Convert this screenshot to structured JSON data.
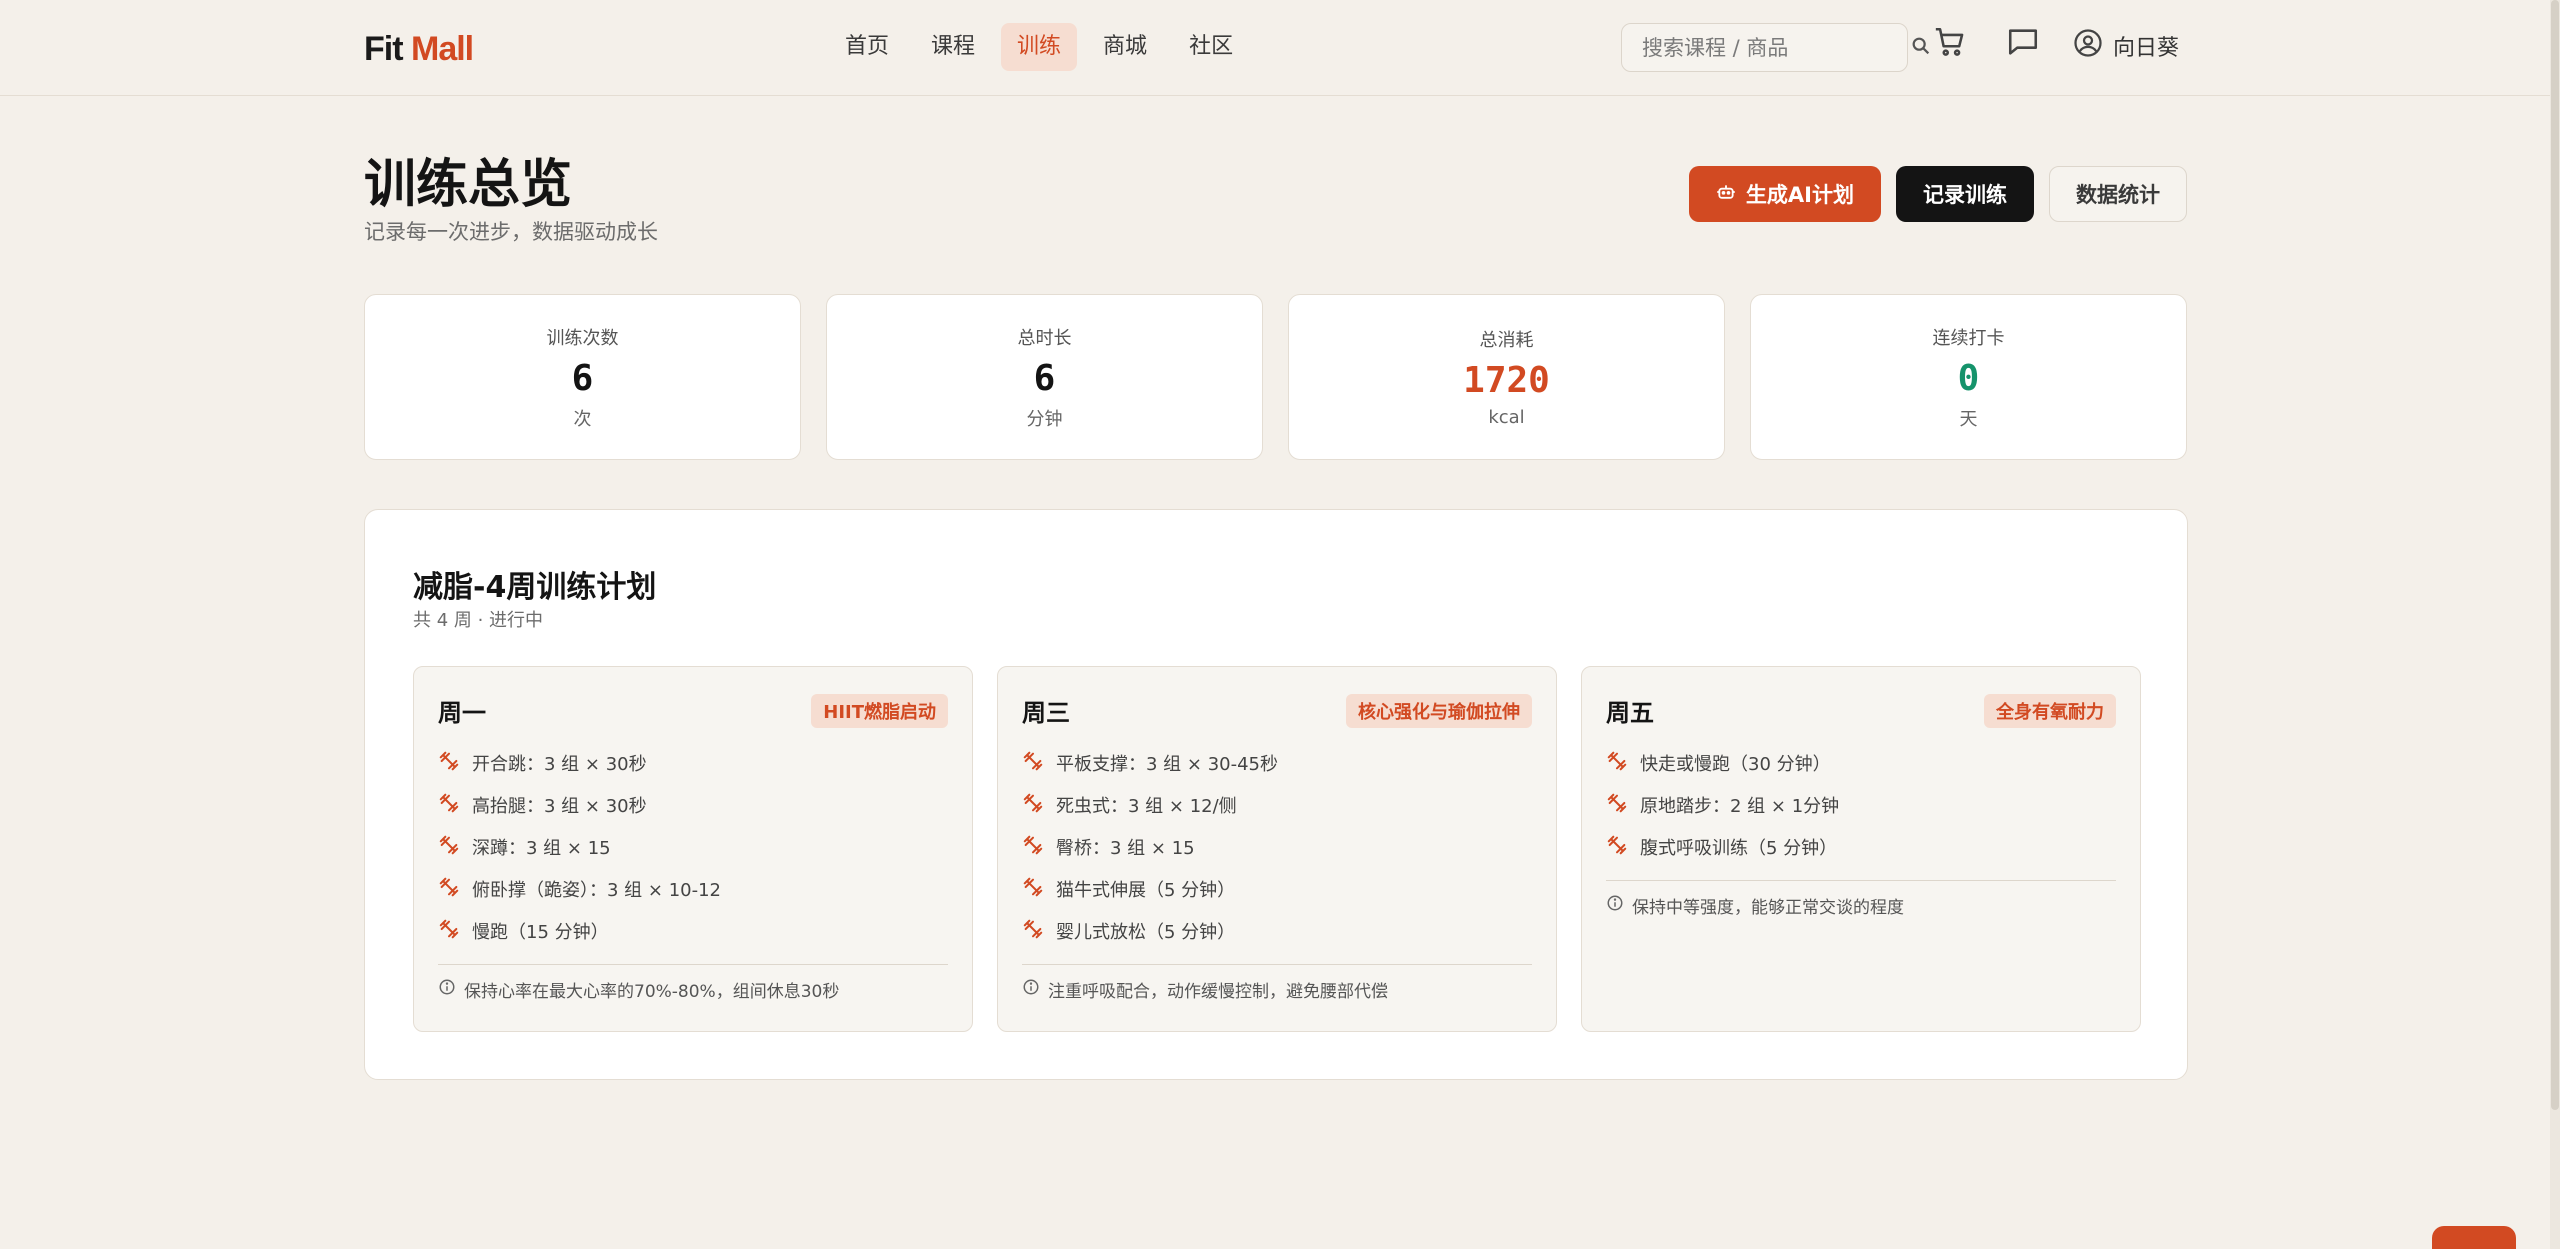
{
  "app": {
    "logo_primary": "Fit",
    "logo_accent": "Mall",
    "accent_color": "#d24a22"
  },
  "nav": {
    "items": [
      {
        "label": "首页",
        "active": false
      },
      {
        "label": "课程",
        "active": false
      },
      {
        "label": "训练",
        "active": true
      },
      {
        "label": "商城",
        "active": false
      },
      {
        "label": "社区",
        "active": false
      }
    ]
  },
  "search": {
    "placeholder": "搜索课程 / 商品",
    "icon": "search-icon"
  },
  "header_icons": [
    "cart-icon",
    "message-icon"
  ],
  "user": {
    "name": "向日葵",
    "icon": "user-circle-icon"
  },
  "page": {
    "title": "训练总览",
    "subtitle": "记录每一次进步，数据驱动成长"
  },
  "actions": {
    "ai_plan": "生成AI计划",
    "record": "记录训练",
    "stats": "数据统计"
  },
  "stats": [
    {
      "label": "训练次数",
      "value": "6",
      "unit": "次",
      "color": "#141414"
    },
    {
      "label": "总时长",
      "value": "6",
      "unit": "分钟",
      "color": "#141414"
    },
    {
      "label": "总消耗",
      "value": "1720",
      "unit": "kcal",
      "color": "#d24a22"
    },
    {
      "label": "连续打卡",
      "value": "0",
      "unit": "天",
      "color": "#15936b"
    }
  ],
  "plan": {
    "title": "减脂-4周训练计划",
    "meta": "共 4 周 · 进行中",
    "days": [
      {
        "name": "周一",
        "tag": "HIIT燃脂启动",
        "exercises": [
          "开合跳：3 组 × 30秒",
          "高抬腿：3 组 × 30秒",
          "深蹲：3 组 × 15",
          "俯卧撑（跪姿）：3 组 × 10-12",
          "慢跑（15 分钟）"
        ],
        "note": "保持心率在最大心率的70%-80%，组间休息30秒"
      },
      {
        "name": "周三",
        "tag": "核心强化与瑜伽拉伸",
        "exercises": [
          "平板支撑：3 组 × 30-45秒",
          "死虫式：3 组 × 12/侧",
          "臀桥：3 组 × 15",
          "猫牛式伸展（5 分钟）",
          "婴儿式放松（5 分钟）"
        ],
        "note": "注重呼吸配合，动作缓慢控制，避免腰部代偿"
      },
      {
        "name": "周五",
        "tag": "全身有氧耐力",
        "exercises": [
          "快走或慢跑（30 分钟）",
          "原地踏步：2 组 × 1分钟",
          "腹式呼吸训练（5 分钟）"
        ],
        "note": "保持中等强度，能够正常交谈的程度"
      }
    ]
  }
}
